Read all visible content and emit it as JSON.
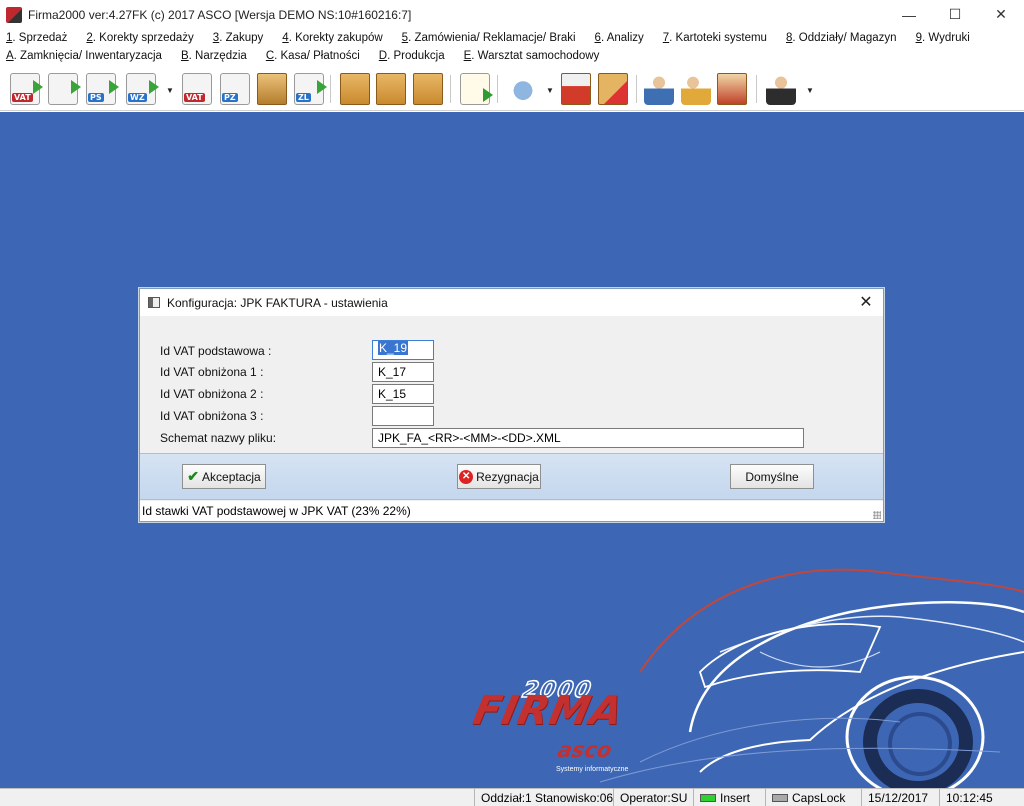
{
  "window": {
    "title": "Firma2000 ver:4.27FK  (c) 2017 ASCO  [Wersja DEMO NS:10#160216:7]",
    "minimize": "—",
    "maximize": "☐",
    "close": "✕"
  },
  "menu": {
    "row1": [
      {
        "key": "1",
        "label": ". Sprzedaż"
      },
      {
        "key": "2",
        "label": ". Korekty sprzedaży"
      },
      {
        "key": "3",
        "label": ". Zakupy"
      },
      {
        "key": "4",
        "label": ". Korekty zakupów"
      },
      {
        "key": "5",
        "label": ". Zamówienia/ Reklamacje/ Braki"
      },
      {
        "key": "6",
        "label": ". Analizy"
      },
      {
        "key": "7",
        "label": ". Kartoteki systemu"
      },
      {
        "key": "8",
        "label": ". Oddziały/ Magazyn"
      },
      {
        "key": "9",
        "label": ". Wydruki"
      }
    ],
    "row2": [
      {
        "key": "A",
        "label": ". Zamknięcia/ Inwentaryzacja"
      },
      {
        "key": "B",
        "label": ". Narzędzia"
      },
      {
        "key": "C",
        "label": ". Kasa/ Płatności"
      },
      {
        "key": "D",
        "label": ". Produkcja"
      },
      {
        "key": "E",
        "label": ". Warsztat samochodowy"
      }
    ]
  },
  "toolbar": {
    "doc_labels": [
      "VAT",
      "PS",
      "WZ",
      "VAT",
      "PZ",
      "ZL"
    ],
    "dropdown_glyph": "▼"
  },
  "dialog": {
    "title": "Konfiguracja: JPK FAKTURA - ustawienia",
    "close": "✕",
    "fields": {
      "vat_basic_label": "Id VAT podstawowa  :",
      "vat_basic_value": "K_19",
      "vat_reduced1_label": "Id VAT obniżona 1  :",
      "vat_reduced1_value": "K_17",
      "vat_reduced2_label": "Id VAT obniżona 2  :",
      "vat_reduced2_value": "K_15",
      "vat_reduced3_label": "Id VAT obniżona 3  :",
      "vat_reduced3_value": "",
      "filename_label": "Schemat nazwy pliku:",
      "filename_value": "JPK_FA_<RR>-<MM>-<DD>.XML"
    },
    "buttons": {
      "accept": "Akceptacja",
      "cancel": "Rezygnacja",
      "defaults": "Domyślne"
    },
    "status": "Id stawki VAT podstawowej w JPK VAT (23% 22%)"
  },
  "logo": {
    "brand": "FIRMA",
    "number": "2000",
    "company": "asco",
    "tagline": "Systemy informatyczne"
  },
  "statusbar": {
    "station": "Oddział:1 Stanowisko:06",
    "operator": "Operator:SU",
    "insert": "Insert",
    "capslock": "CapsLock",
    "date": "15/12/2017",
    "time": "10:12:45"
  },
  "colors": {
    "desktop": "#3d67b4",
    "brand_red": "#c2302f",
    "led_on": "#2fd12f"
  }
}
